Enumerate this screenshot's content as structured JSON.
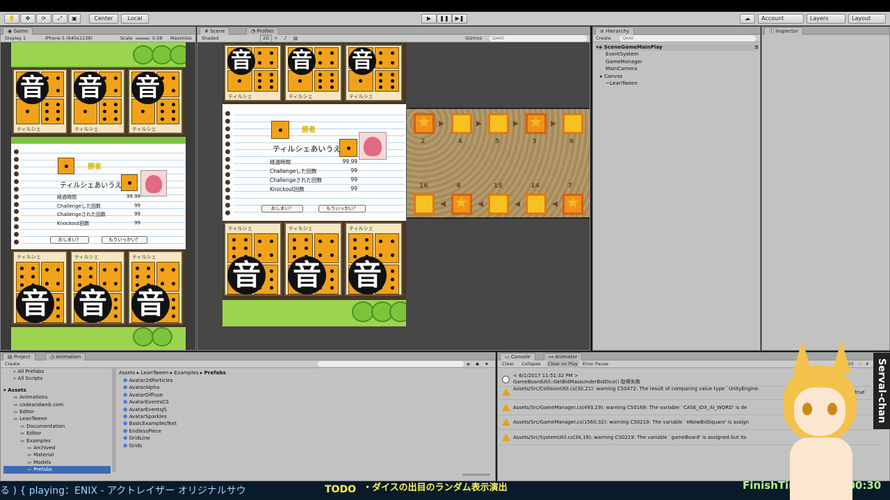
{
  "toolbar": {
    "center": "Center",
    "local": "Local",
    "account": "Account",
    "layers": "Layers",
    "layout": "Layout"
  },
  "game_panel": {
    "tab": "Game",
    "display": "Display 1",
    "resolution": "iPhone 5 (640x1136)",
    "scale_label": "Scale",
    "scale_value": "0.58",
    "maximize": "Maximize"
  },
  "scene_panel": {
    "tab_scene": "Scene",
    "tab_profiler": "Profiler",
    "shading": "Shaded",
    "mode_2d": "2D",
    "gizmos": "Gizmos",
    "search": "Q▾All"
  },
  "hierarchy": {
    "tab": "Hierarchy",
    "create": "Create",
    "search": "Q▾All",
    "scene": "SceneGameMainPlay",
    "items": [
      "EventSystem",
      "GameManager",
      "MainCamera",
      "Canvas",
      "~LeanTween"
    ]
  },
  "inspector": {
    "tab": "Inspector"
  },
  "project": {
    "tab_project": "Project",
    "tab_animation": "Animation",
    "create": "Create",
    "favorites": [
      "All Prefabs",
      "All Scripts"
    ],
    "assets_root": "Assets",
    "folders": [
      "Animations",
      "codeandweb.com",
      "Editor",
      "LeanTween",
      "Documentation",
      "Editor",
      "Examples",
      "Archived",
      "Material",
      "Models",
      "Prefabs"
    ],
    "breadcrumb": [
      "Assets",
      "LeanTween",
      "Examples",
      "Prefabs"
    ],
    "files": [
      "Avatar2dParticles",
      "AvatarAlpha",
      "AvatarDiffuse",
      "AvatarEventsCS",
      "AvatarEventsJS",
      "AvatarSparkles",
      "BasicExamplesText",
      "EndlessPiece",
      "GridLine",
      "Grids"
    ]
  },
  "console": {
    "tab": "Console",
    "tab_animator": "Animator",
    "clear": "Clear",
    "collapse": "Collapse",
    "clear_on_play": "Clear on Play",
    "error_pause": "Error Pause",
    "count_info": "10",
    "count_warn": "4",
    "rows": [
      {
        "line1": "< 6/1/2017 11:51:32 PM >",
        "line2": "GameBoardUtil::GetBidMassUnderBidDice() 取得失敗",
        "kind": "info"
      },
      {
        "line1": "Assets/Src/CollisionUtil.cs(30,21): warning CS0472: The result of comparing value type `UnityEngine.",
        "line2": "is `true`",
        "kind": "warn"
      },
      {
        "line1": "Assets/Src/GameManager.cs(493,19): warning CS0168: The variable `CASE_IDX_AI_WORD' is de",
        "line2": "",
        "kind": "warn"
      },
      {
        "line1": "Assets/Src/GameManager.cs(1560,32): warning CS0219: The variable `eNowBidSquare' is assign",
        "line2": "",
        "kind": "warn"
      },
      {
        "line1": "Assets/Src/SystemUtil.cs(34,19): warning CS0219: The variable `gameBoard' is assigned but its",
        "line2": "",
        "kind": "warn"
      }
    ]
  },
  "game": {
    "card_name": "ティルシェ",
    "kanji": "音",
    "win_label": "勝者",
    "winner_name": "ティルシェあいうえ",
    "stats": [
      {
        "label": "経過時間",
        "value": "99.99"
      },
      {
        "label": "Challengeした回数",
        "value": "99"
      },
      {
        "label": "Challengeされた回数",
        "value": "99"
      },
      {
        "label": "Knockout回数",
        "value": "99"
      }
    ],
    "quit": "おしまい？",
    "retry": "もういっかい？"
  },
  "board": {
    "top_numbers": [
      "2",
      "4",
      "5",
      "3",
      "6"
    ],
    "bottom_numbers": [
      "16",
      "8",
      "15",
      "14",
      "7"
    ]
  },
  "overlay": {
    "playing": "る ) { playing：ENIX - アクトレイザー オリジナルサウ",
    "todo_label": "TODO",
    "todo_text": "・ダイスの出目のランダム表示演出",
    "finish": "FinishTime about 00:30",
    "vertical_name": "Serval-chan"
  }
}
